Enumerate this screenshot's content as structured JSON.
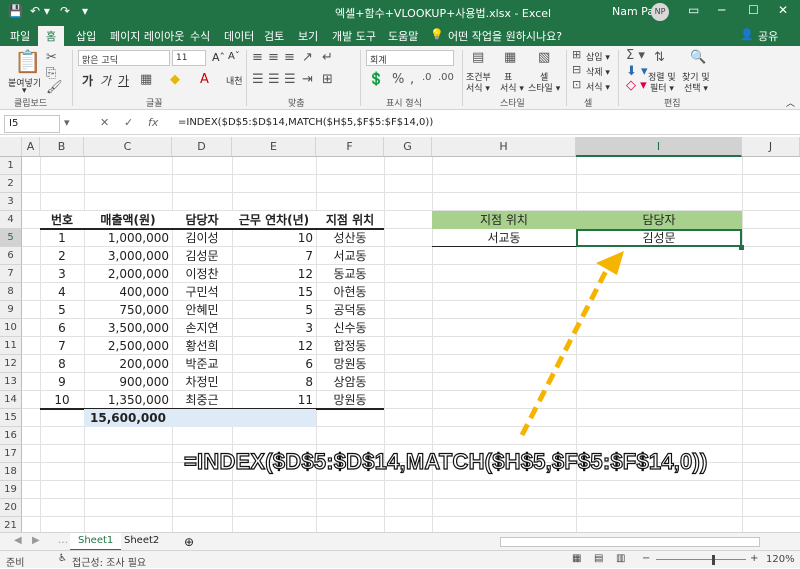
{
  "titlebar": {
    "title": "엑셀+함수+VLOOKUP+사용법.xlsx  -  Excel",
    "user": "Nam Paul",
    "avatar": "NP",
    "quick_access": [
      "💾",
      "↶ ▾",
      "↷",
      "▾"
    ],
    "window_buttons": [
      "▭",
      "─",
      "☐",
      "✕"
    ]
  },
  "tabs": [
    "파일",
    "홈",
    "삽입",
    "페이지 레이아웃",
    "수식",
    "데이터",
    "검토",
    "보기",
    "개발 도구",
    "도움말",
    "어떤 작업을 원하시나요?"
  ],
  "share": "공유",
  "ribbon": {
    "paste": "붙여넣기",
    "paste_arrow": "▾",
    "font_name": "맑은 고딕",
    "font_size": "11",
    "number_format": "회계",
    "styles": [
      "조건부",
      "서식 ▾",
      "표",
      "서식 ▾",
      "셀",
      "스타일 ▾"
    ],
    "cells": [
      "삽입 ▾",
      "삭제 ▾",
      "서식 ▾"
    ],
    "editing": [
      "정렬 및",
      "필터 ▾",
      "찾기 및",
      "선택 ▾"
    ],
    "groups": [
      "클립보드",
      "글꼴",
      "맞춤",
      "표시 형식",
      "스타일",
      "셀",
      "편집"
    ]
  },
  "formula_bar": {
    "name_box": "I5",
    "formula": "=INDEX($D$5:$D$14,MATCH($H$5,$F$5:$F$14,0))"
  },
  "columns": [
    "A",
    "B",
    "C",
    "D",
    "E",
    "F",
    "G",
    "H",
    "I",
    "J"
  ],
  "rows": [
    "1",
    "2",
    "3",
    "4",
    "5",
    "6",
    "7",
    "8",
    "9",
    "10",
    "11",
    "12",
    "13",
    "14",
    "15",
    "16",
    "17",
    "18",
    "19",
    "20",
    "21"
  ],
  "table": {
    "headers": [
      "번호",
      "매출액(원)",
      "담당자",
      "근무 연차(년)",
      "지점 위치"
    ],
    "rows": [
      [
        "1",
        "1,000,000",
        "김이성",
        "10",
        "성산동"
      ],
      [
        "2",
        "3,000,000",
        "김성문",
        "7",
        "서교동"
      ],
      [
        "3",
        "2,000,000",
        "이정찬",
        "12",
        "동교동"
      ],
      [
        "4",
        "400,000",
        "구민석",
        "15",
        "아현동"
      ],
      [
        "5",
        "750,000",
        "안혜민",
        "5",
        "공덕동"
      ],
      [
        "6",
        "3,500,000",
        "손지연",
        "3",
        "신수동"
      ],
      [
        "7",
        "2,500,000",
        "황선희",
        "12",
        "합정동"
      ],
      [
        "8",
        "200,000",
        "박준교",
        "6",
        "망원동"
      ],
      [
        "9",
        "900,000",
        "차정민",
        "8",
        "상암동"
      ],
      [
        "10",
        "1,350,000",
        "최중근",
        "11",
        "망원동"
      ]
    ],
    "total": "15,600,000"
  },
  "lookup": {
    "header_h": "지점 위치",
    "header_i": "담당자",
    "value_h": "서교동",
    "value_i": "김성문"
  },
  "overlay_formula": "=INDEX($D$5:$D$14,MATCH($H$5,$F$5:$F$14,0))",
  "sheets": [
    "Sheet1",
    "Sheet2"
  ],
  "status": {
    "mode": "준비",
    "accessibility": "접근성: 조사 필요",
    "zoom": "120%"
  },
  "colors": {
    "excel_green": "#217346",
    "header_green": "#a9d18e",
    "total_blue": "#deebf7",
    "arrow_orange": "#f4b400"
  }
}
